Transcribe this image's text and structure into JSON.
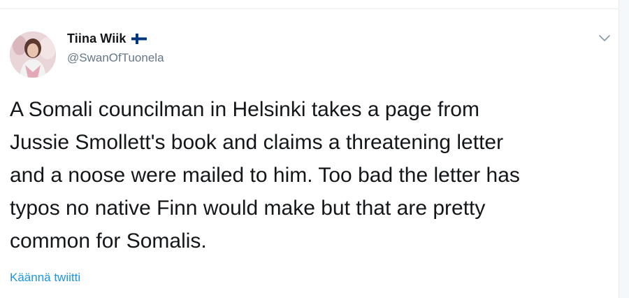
{
  "tweet": {
    "author": {
      "display_name": "Tiina Wiik",
      "handle": "@SwanOfTuonela",
      "flag": "finland-flag-icon",
      "avatar": "profile-photo"
    },
    "text_lines": [
      "A Somali councilman in Helsinki takes a page from",
      "Jussie Smollett's book and claims a threatening letter",
      "and a noose were mailed to him. Too bad the letter has",
      "typos no native Finn would make but that are pretty",
      "common for Somalis."
    ],
    "translate_label": "Käännä twiitti",
    "menu_icon": "chevron-down-icon"
  },
  "colors": {
    "text_primary": "#14171a",
    "text_secondary": "#657786",
    "link": "#1b95e0",
    "flag_blue": "#003580",
    "border": "#e6ecf0"
  }
}
